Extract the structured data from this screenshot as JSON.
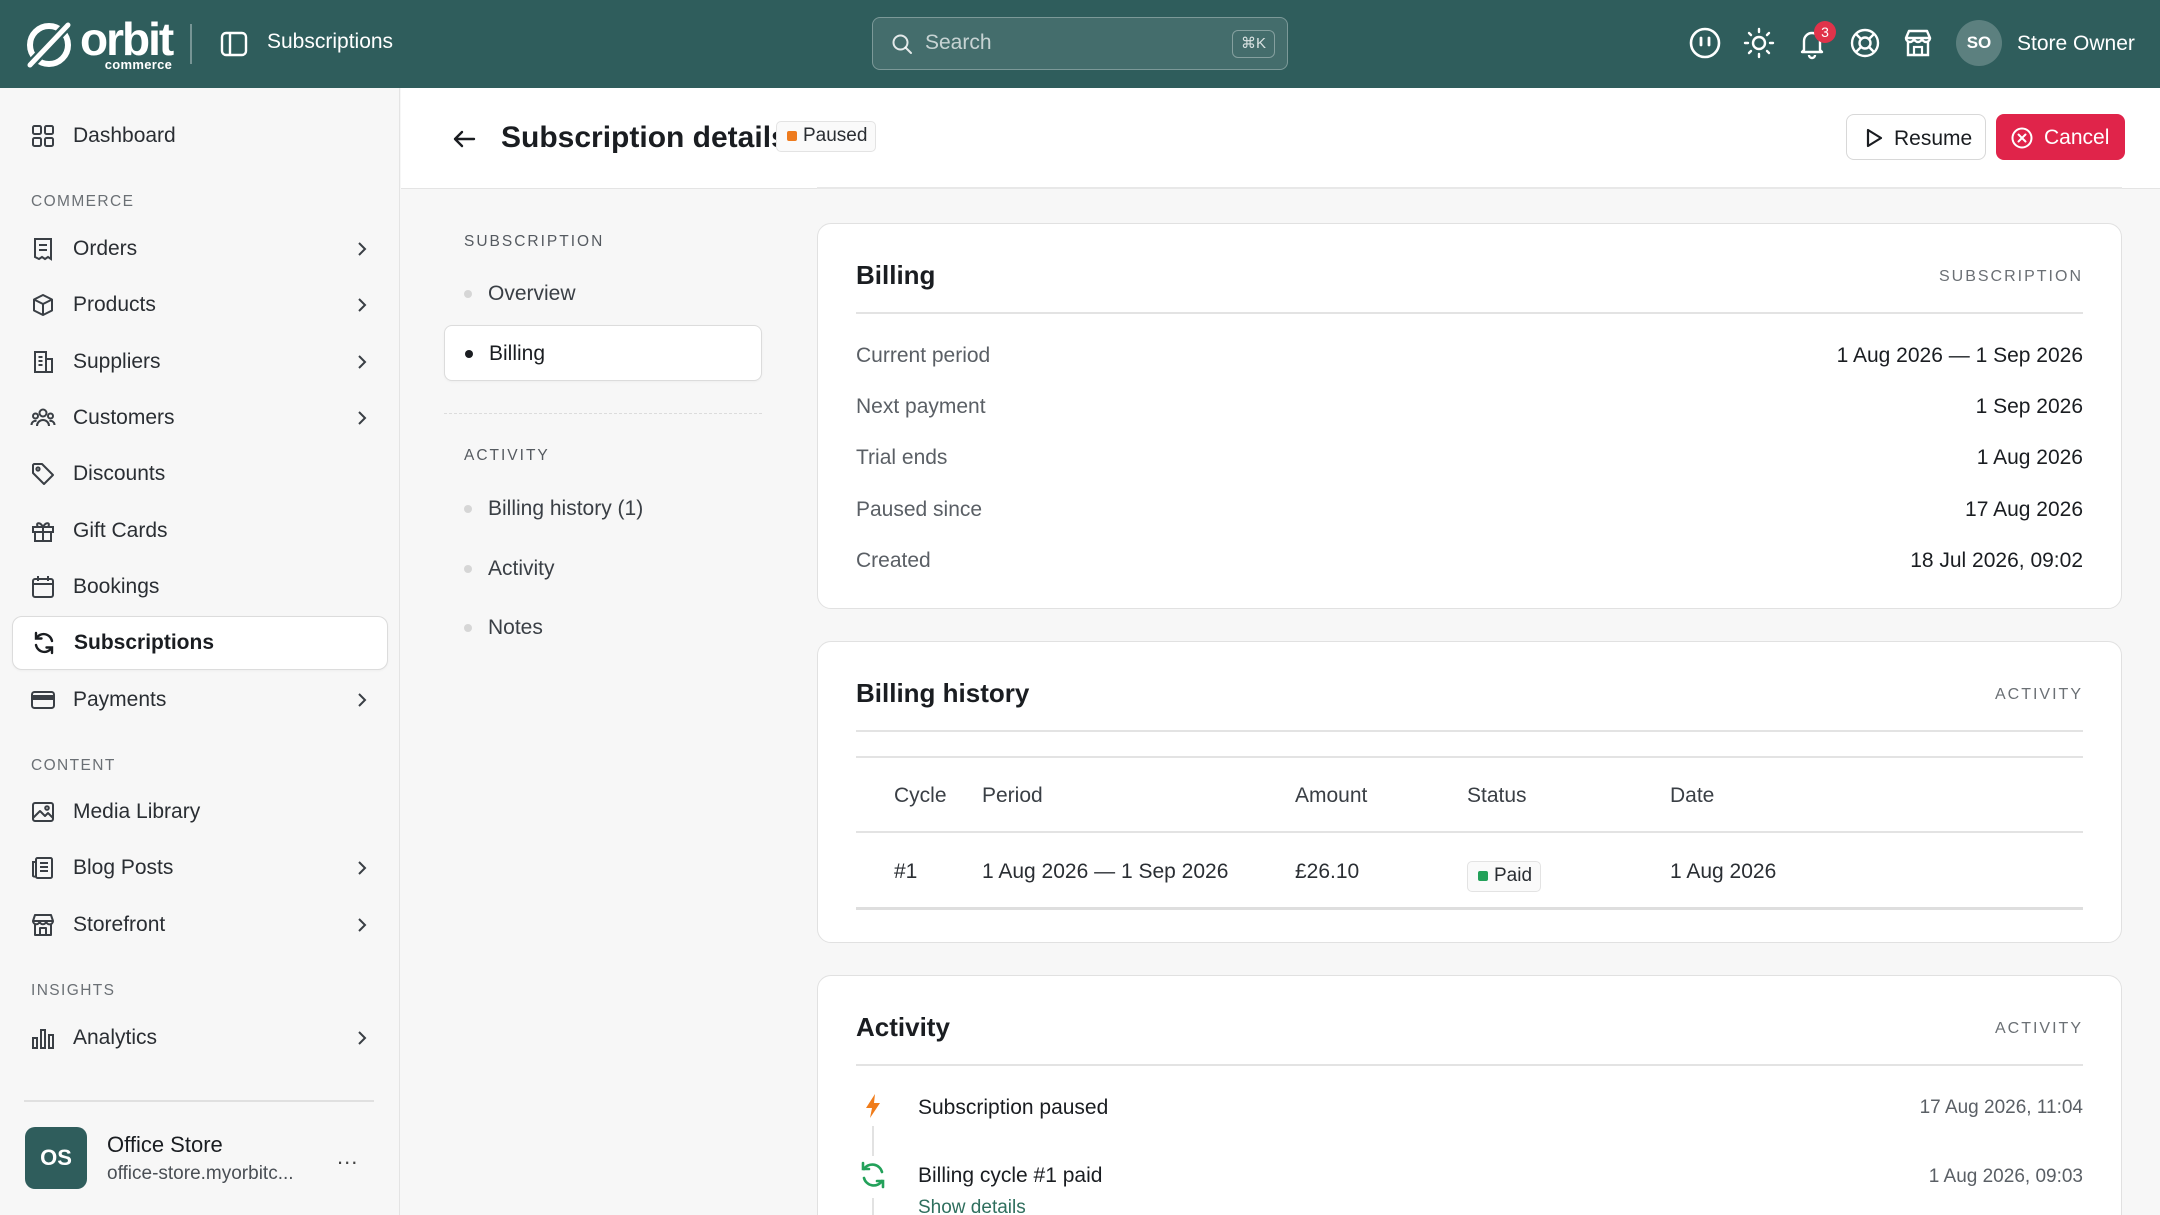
{
  "topbar": {
    "brand_name": "orbit",
    "brand_sub": "commerce",
    "section_title": "Subscriptions",
    "search_placeholder": "Search",
    "search_shortcut": "⌘K",
    "notification_count": "3",
    "user_initials": "SO",
    "user_name": "Store Owner",
    "icons": [
      "panel-toggle-icon",
      "search-icon",
      "smiley-icon",
      "sun-icon",
      "bell-icon",
      "help-lifebuoy-icon",
      "storefront-icon"
    ]
  },
  "sidebar": {
    "dashboard": "Dashboard",
    "sections": {
      "commerce": "COMMERCE",
      "content": "CONTENT",
      "insights": "INSIGHTS"
    },
    "commerce_items": [
      {
        "label": "Orders",
        "icon": "receipt-icon"
      },
      {
        "label": "Products",
        "icon": "box-icon"
      },
      {
        "label": "Suppliers",
        "icon": "building-icon"
      },
      {
        "label": "Customers",
        "icon": "users-icon"
      },
      {
        "label": "Discounts",
        "icon": "tag-icon"
      },
      {
        "label": "Gift Cards",
        "icon": "gift-icon"
      },
      {
        "label": "Bookings",
        "icon": "calendar-icon"
      },
      {
        "label": "Subscriptions",
        "icon": "refresh-icon",
        "active": true
      },
      {
        "label": "Payments",
        "icon": "credit-card-icon"
      }
    ],
    "content_items": [
      {
        "label": "Media Library",
        "icon": "image-icon"
      },
      {
        "label": "Blog Posts",
        "icon": "document-icon"
      },
      {
        "label": "Storefront",
        "icon": "store-icon"
      }
    ],
    "insights_items": [
      {
        "label": "Analytics",
        "icon": "bar-chart-icon"
      }
    ],
    "store": {
      "initials": "OS",
      "name": "Office Store",
      "url": "office-store.myorbitc...",
      "more": "..."
    }
  },
  "header": {
    "title": "Subscription details",
    "status": "Paused",
    "resume_label": "Resume",
    "cancel_label": "Cancel"
  },
  "section_nav": {
    "subscription_heading": "SUBSCRIPTION",
    "subscription_items": [
      "Overview",
      "Billing"
    ],
    "active": "Billing",
    "activity_heading": "ACTIVITY",
    "activity_items": [
      "Billing history (1)",
      "Activity",
      "Notes"
    ]
  },
  "billing": {
    "title": "Billing",
    "tag": "SUBSCRIPTION",
    "rows": [
      {
        "label": "Current period",
        "value": "1 Aug 2026 — 1 Sep 2026"
      },
      {
        "label": "Next payment",
        "value": "1 Sep 2026"
      },
      {
        "label": "Trial ends",
        "value": "1 Aug 2026"
      },
      {
        "label": "Paused since",
        "value": "17 Aug 2026"
      },
      {
        "label": "Created",
        "value": "18 Jul 2026, 09:02"
      }
    ]
  },
  "billing_history": {
    "title": "Billing history",
    "tag": "ACTIVITY",
    "columns": [
      "Cycle",
      "Period",
      "Amount",
      "Status",
      "Date"
    ],
    "rows": [
      {
        "cycle": "#1",
        "period": "1 Aug 2026 — 1 Sep 2026",
        "amount": "£26.10",
        "status": "Paid",
        "date": "1 Aug 2026"
      }
    ]
  },
  "activity": {
    "title": "Activity",
    "tag": "ACTIVITY",
    "events": [
      {
        "title": "Subscription paused",
        "time": "17 Aug 2026, 11:04",
        "icon": "lightning-icon"
      },
      {
        "title": "Billing cycle #1 paid",
        "time": "1 Aug 2026, 09:03",
        "icon": "refresh-icon",
        "link": "Show details"
      }
    ]
  },
  "colors": {
    "topbar": "#2f5d5c",
    "cancel": "#e0244a",
    "paused_dot": "#ee7b1e",
    "paid_dot": "#23a15a",
    "link": "#2f6f5e"
  }
}
